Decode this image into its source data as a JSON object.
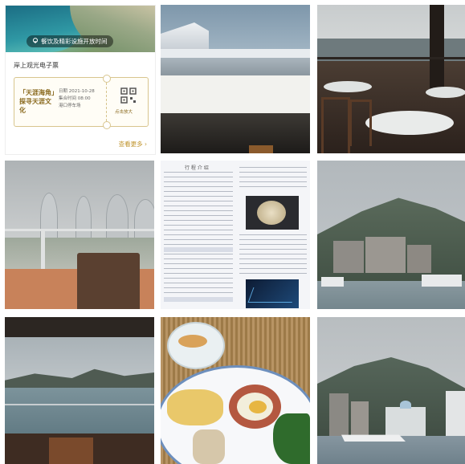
{
  "grid": {
    "cells": [
      {
        "name": "ticket-screenshot"
      },
      {
        "name": "ship-deck-photo"
      },
      {
        "name": "restaurant-terrace-photo"
      },
      {
        "name": "balcony-view-photo"
      },
      {
        "name": "itinerary-document-photo"
      },
      {
        "name": "misty-mountain-photo"
      },
      {
        "name": "bay-view-photo"
      },
      {
        "name": "breakfast-plate-photo"
      },
      {
        "name": "harbor-mountain-photo"
      }
    ]
  },
  "ticket": {
    "banner_text": "餐饮及精彩设施开放时间",
    "header": "岸上观光电子票",
    "name": "「天涯海角」探寻天涯文化",
    "date_line": "日期 2021-10-28",
    "time_line": "集合时间 08:00",
    "place_line": "港口停车场",
    "qr_label": "点击放大",
    "more_label": "查看更多 ›",
    "icons": [
      "location-pin-icon",
      "qr-code-icon"
    ]
  },
  "itinerary_doc": {
    "heading": "行 程 介 绍"
  },
  "colors": {
    "gold_accent": "#c0952e",
    "ticket_border": "#d8c58e",
    "sea": "#2f98a4"
  }
}
